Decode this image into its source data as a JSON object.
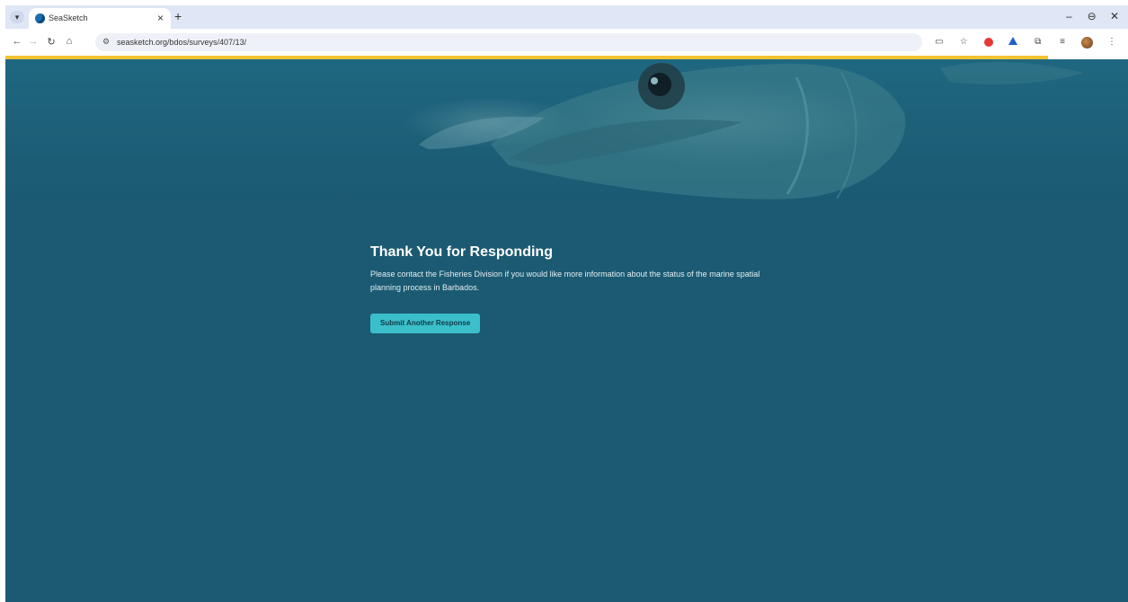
{
  "browser": {
    "tab_title": "SeaSketch",
    "tab_close": "×",
    "new_tab": "+",
    "url": "seasketch.org/bdos/surveys/407/13/",
    "window_controls": [
      "–",
      "⊖",
      "✕"
    ]
  },
  "page": {
    "title": "Thank You for Responding",
    "body": "Please contact the Fisheries Division if you would like more information about the status of the marine spatial planning process in Barbados.",
    "button_label": "Submit Another Response"
  },
  "colors": {
    "background": "#1b5a72",
    "button": "#3bbfcb",
    "progress": "#f2c230"
  },
  "icons": [
    "tab-menu-icon",
    "favicon-icon",
    "back-icon",
    "forward-icon",
    "reload-icon",
    "home-icon",
    "site-info-icon",
    "cast-icon",
    "bookmark-star-icon",
    "extension-red-icon",
    "extension-blue-icon",
    "extensions-icon",
    "reading-list-icon",
    "profile-avatar-icon",
    "more-menu-icon"
  ]
}
